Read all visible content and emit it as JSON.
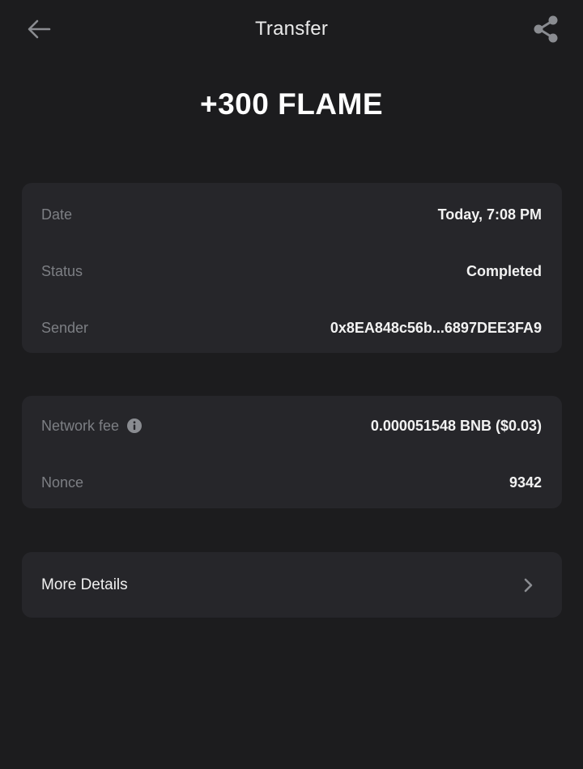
{
  "header": {
    "title": "Transfer",
    "back_icon": "arrow-left-icon",
    "share_icon": "share-icon"
  },
  "amount": "+300 FLAME",
  "details": {
    "date_label": "Date",
    "date_value": "Today, 7:08 PM",
    "status_label": "Status",
    "status_value": "Completed",
    "sender_label": "Sender",
    "sender_value": "0x8EA848c56b...6897DEE3FA9"
  },
  "fees": {
    "network_fee_label": "Network fee",
    "network_fee_value": "0.000051548 BNB ($0.03)",
    "info_icon": "info-icon",
    "nonce_label": "Nonce",
    "nonce_value": "9342"
  },
  "more": {
    "label": "More Details",
    "icon": "chevron-right-icon"
  },
  "colors": {
    "background": "#1c1c1e",
    "card": "#26262a",
    "label": "#7d7f84",
    "value": "#f2f2f2"
  }
}
